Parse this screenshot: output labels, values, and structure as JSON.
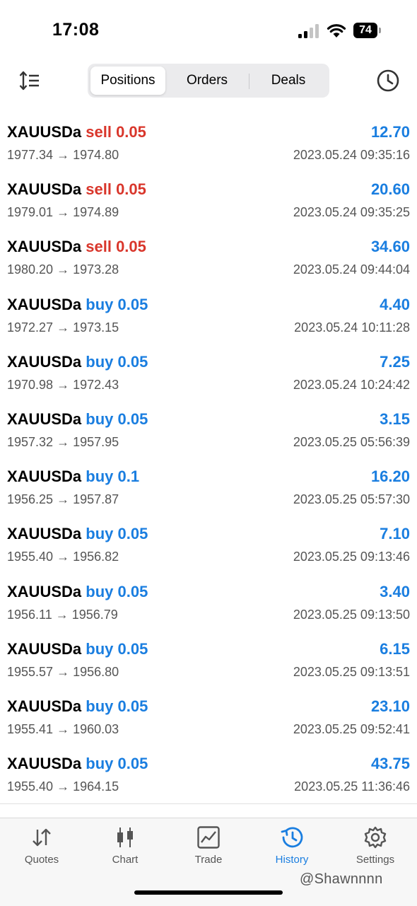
{
  "status_bar": {
    "time": "17:08",
    "battery": "74"
  },
  "header": {
    "tabs": [
      {
        "label": "Positions",
        "active": true
      },
      {
        "label": "Orders",
        "active": false
      },
      {
        "label": "Deals",
        "active": false
      }
    ],
    "left_icon": "sort-icon",
    "right_icon": "clock-icon"
  },
  "deals": [
    {
      "symbol": "XAUUSDa",
      "side": "sell",
      "volume": "sell 0.05",
      "prices": "1977.34 → 1974.80",
      "profit": "12.70",
      "time": "2023.05.24 09:35:16"
    },
    {
      "symbol": "XAUUSDa",
      "side": "sell",
      "volume": "sell 0.05",
      "prices": "1979.01 → 1974.89",
      "profit": "20.60",
      "time": "2023.05.24 09:35:25"
    },
    {
      "symbol": "XAUUSDa",
      "side": "sell",
      "volume": "sell 0.05",
      "prices": "1980.20 → 1973.28",
      "profit": "34.60",
      "time": "2023.05.24 09:44:04"
    },
    {
      "symbol": "XAUUSDa",
      "side": "buy",
      "volume": "buy 0.05",
      "prices": "1972.27 → 1973.15",
      "profit": "4.40",
      "time": "2023.05.24 10:11:28"
    },
    {
      "symbol": "XAUUSDa",
      "side": "buy",
      "volume": "buy 0.05",
      "prices": "1970.98 → 1972.43",
      "profit": "7.25",
      "time": "2023.05.24 10:24:42"
    },
    {
      "symbol": "XAUUSDa",
      "side": "buy",
      "volume": "buy 0.05",
      "prices": "1957.32 → 1957.95",
      "profit": "3.15",
      "time": "2023.05.25 05:56:39"
    },
    {
      "symbol": "XAUUSDa",
      "side": "buy",
      "volume": "buy 0.1",
      "prices": "1956.25 → 1957.87",
      "profit": "16.20",
      "time": "2023.05.25 05:57:30"
    },
    {
      "symbol": "XAUUSDa",
      "side": "buy",
      "volume": "buy 0.05",
      "prices": "1955.40 → 1956.82",
      "profit": "7.10",
      "time": "2023.05.25 09:13:46"
    },
    {
      "symbol": "XAUUSDa",
      "side": "buy",
      "volume": "buy 0.05",
      "prices": "1956.11 → 1956.79",
      "profit": "3.40",
      "time": "2023.05.25 09:13:50"
    },
    {
      "symbol": "XAUUSDa",
      "side": "buy",
      "volume": "buy 0.05",
      "prices": "1955.57 → 1956.80",
      "profit": "6.15",
      "time": "2023.05.25 09:13:51"
    },
    {
      "symbol": "XAUUSDa",
      "side": "buy",
      "volume": "buy 0.05",
      "prices": "1955.41 → 1960.03",
      "profit": "23.10",
      "time": "2023.05.25 09:52:41"
    },
    {
      "symbol": "XAUUSDa",
      "side": "buy",
      "volume": "buy 0.05",
      "prices": "1955.40 → 1964.15",
      "profit": "43.75",
      "time": "2023.05.25 11:36:46"
    }
  ],
  "colors": {
    "sell": "#d9362b",
    "buy": "#1a7ee0",
    "active_tab": "#1a7ee0"
  },
  "tab_bar": [
    {
      "label": "Quotes",
      "icon": "quotes-icon",
      "active": false
    },
    {
      "label": "Chart",
      "icon": "chart-icon",
      "active": false
    },
    {
      "label": "Trade",
      "icon": "trade-icon",
      "active": false
    },
    {
      "label": "History",
      "icon": "history-icon",
      "active": true
    },
    {
      "label": "Settings",
      "icon": "settings-icon",
      "active": false
    }
  ],
  "watermark": "@Shawnnnn"
}
